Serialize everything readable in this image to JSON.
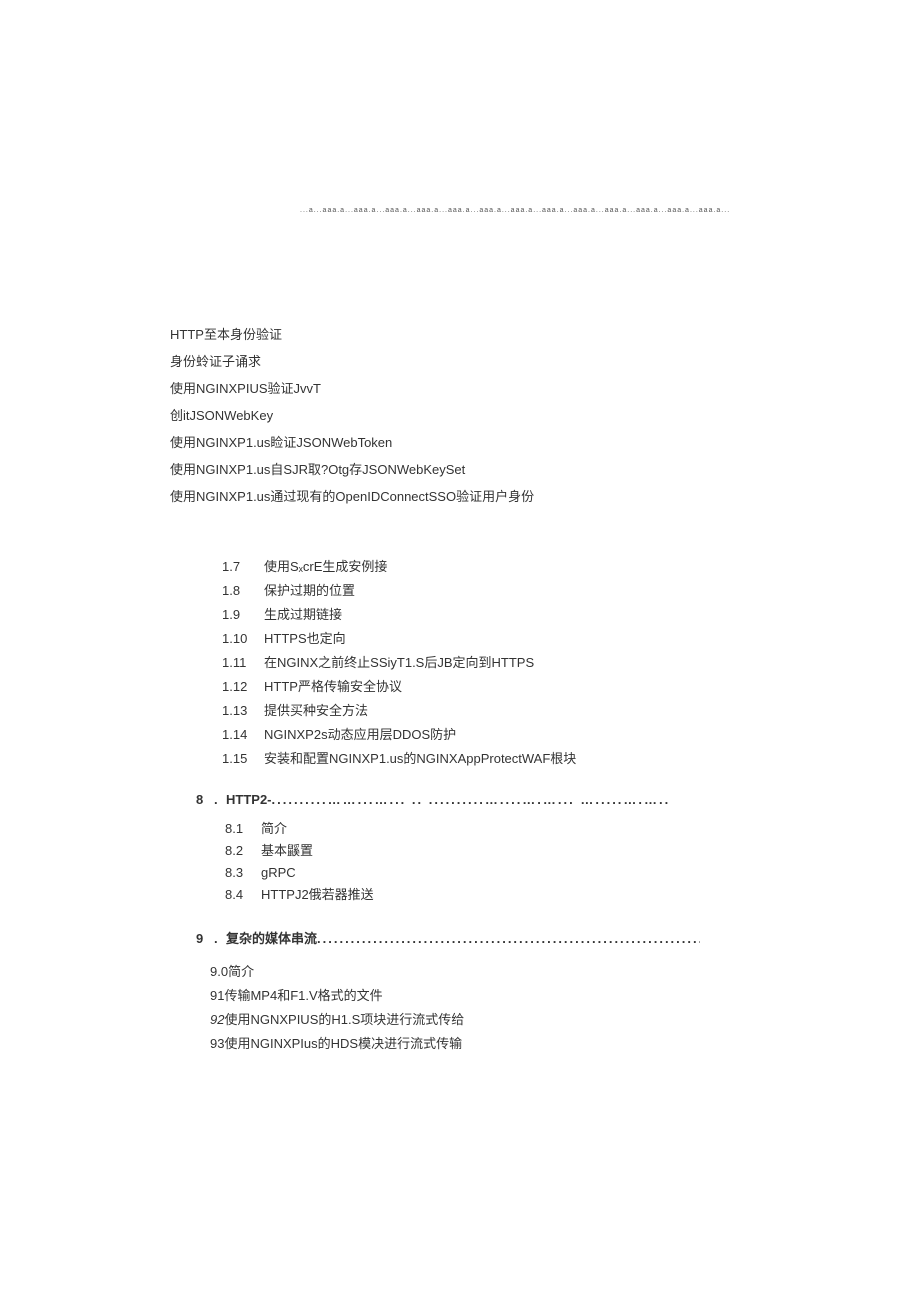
{
  "dotted_top": "...a...aaa.a...aaa.a...aaa.a...aaa.a...aaa.a...aaa.a...aaa.a...aaa.a...aaa.a...aaa.a...aaa.a...aaa.a...aaa.a...",
  "block1": [
    "HTTP至本身份验证",
    "身份蛉证子诵求",
    "使用NGINXPIUS验证JvvT",
    "创itJSONWebKey",
    "使用NGINXP1.us睑证JSONWebToken",
    "使用NGINXP1.us自SJR取?Otg存JSONWebKeySet",
    "使用NGINXP1.us通过现有的OpenIDConnectSSO验证用户身份"
  ],
  "block2": [
    {
      "num": "1.7",
      "txt": "使用SₓcrE生成安例接"
    },
    {
      "num": "1.8",
      "txt": "保护过期的位置"
    },
    {
      "num": "1.9",
      "txt": "生成过期链接"
    },
    {
      "num": "1.10",
      "txt": "HTTPS也定向"
    },
    {
      "num": "1.11",
      "txt": "在NGINX之前终止SSiyT1.S后JB定向到HTTPS"
    },
    {
      "num": "1.12",
      "txt": "HTTP严格传输安全协议"
    },
    {
      "num": "1.13",
      "txt": "提供买种安全方法"
    },
    {
      "num": "1.14",
      "txt": "NGINXP2s动态应用层DDOS防护"
    },
    {
      "num": "1.15",
      "txt": "安装和配置NGINXP1.us的NGINXAppProtectWAF根块"
    }
  ],
  "sec8": {
    "num": "8",
    "dot": ".",
    "title": "HTTP2-",
    "dots": "..........……...…... .. ..........…....….…... ….....….….."
  },
  "sec8_sub": [
    {
      "num": "8.1",
      "txt": "简介"
    },
    {
      "num": "8.2",
      "txt": "基本鼷置"
    },
    {
      "num": "8.3",
      "txt": "gRPC"
    },
    {
      "num": "8.4",
      "txt": "HTTPJ2俄若器推送"
    }
  ],
  "sec9": {
    "num": "9",
    "dot": ".",
    "title": "复杂的媒体串流",
    "dots": "................................................................................"
  },
  "sec9_sub": [
    {
      "prefix": "9.0",
      "txt": "简介"
    },
    {
      "prefix": "91",
      "txt": "传输MP4和F1.V格式的文件"
    },
    {
      "prefix": "92",
      "txt": "使用NGNXPIUS的H1.S项块进行流式传给",
      "italic_prefix": true
    },
    {
      "prefix": "93",
      "txt": "使用NGINXPIus的HDS模决进行流式传输"
    }
  ]
}
